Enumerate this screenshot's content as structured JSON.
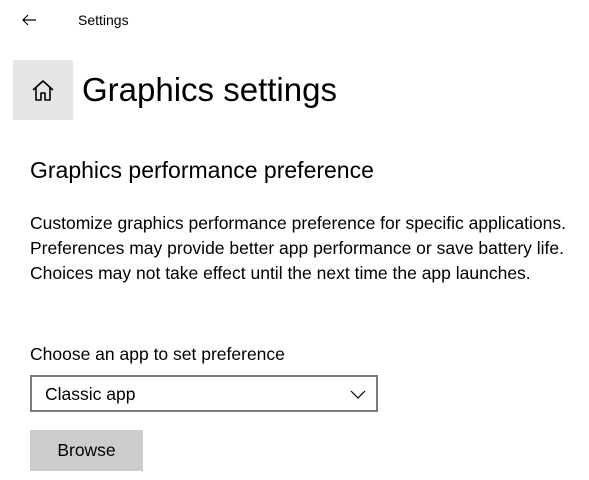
{
  "window": {
    "title": "Settings"
  },
  "header": {
    "home_icon": "home-icon",
    "back_icon": "arrow-left-icon",
    "page_title": "Graphics settings"
  },
  "section": {
    "title": "Graphics performance preference",
    "description": "Customize graphics performance preference for specific applications. Preferences may provide better app performance or save battery life. Choices may not take effect until the next time the app launches.",
    "choose_label": "Choose an app to set preference",
    "dropdown_value": "Classic app",
    "browse_label": "Browse"
  },
  "colors": {
    "home_tile_bg": "#e6e6e6",
    "button_bg": "#cccccc",
    "dropdown_border": "#7a7a7a"
  }
}
